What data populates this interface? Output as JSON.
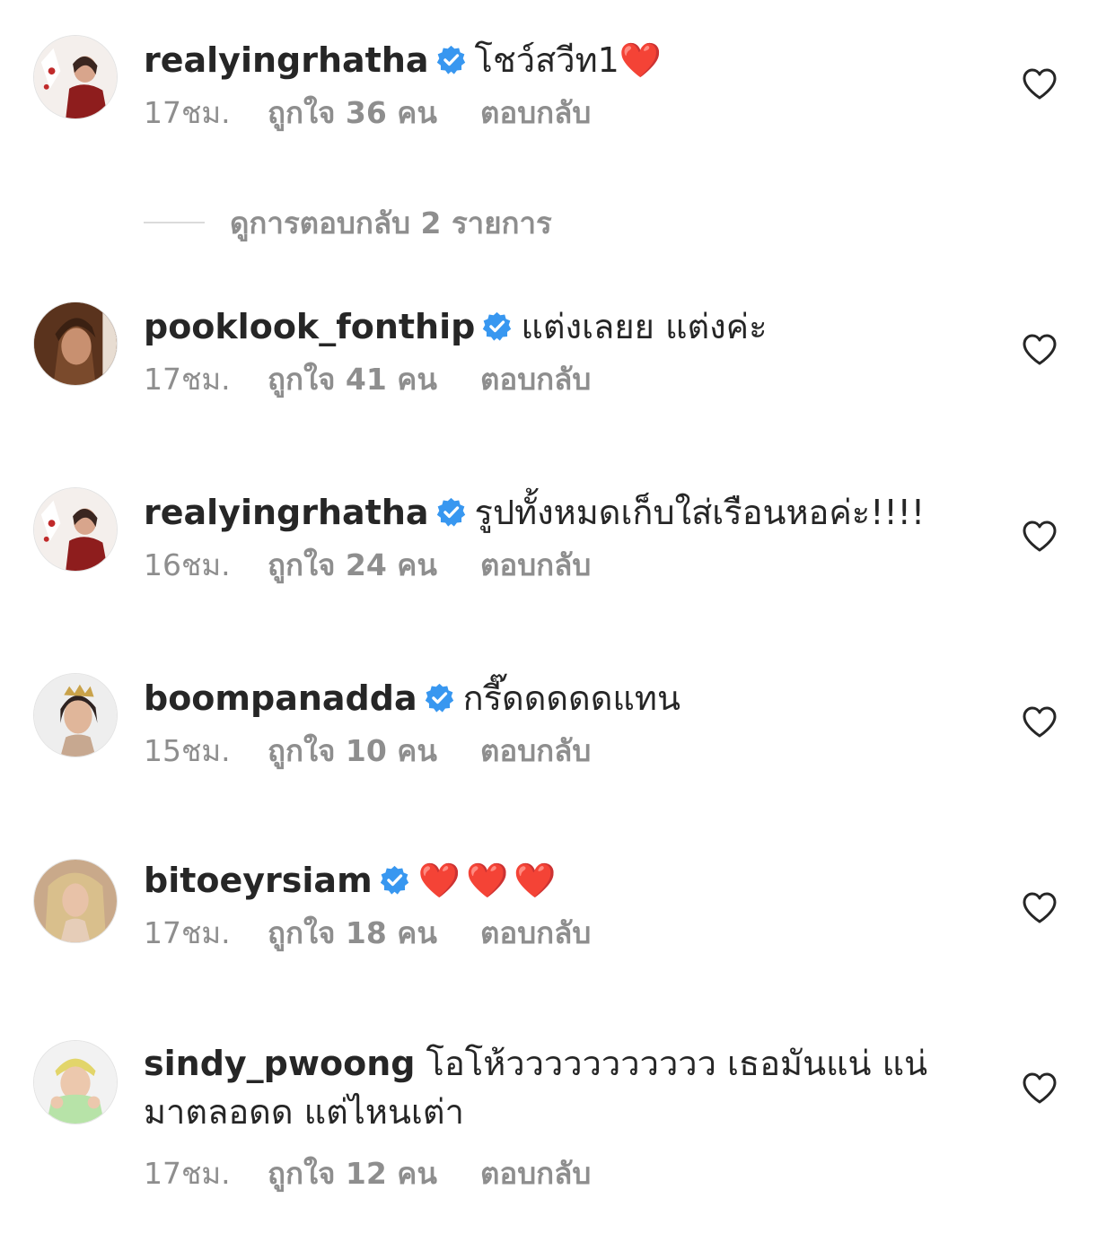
{
  "colors": {
    "text": "#262626",
    "secondary": "#8e8e8e",
    "verified": "#3897f0",
    "heart_emoji": "#e0121f"
  },
  "comments": [
    {
      "username": "realyingrhatha",
      "verified": true,
      "text": "โชว์สวีท1❤️",
      "time": "17ชม.",
      "likes": "ถูกใจ 36 คน",
      "reply": "ตอบกลับ"
    },
    {
      "username": "pooklook_fonthip",
      "verified": true,
      "text": "แต่งเลยย แต่งค่ะ",
      "time": "17ชม.",
      "likes": "ถูกใจ 41 คน",
      "reply": "ตอบกลับ"
    },
    {
      "username": "realyingrhatha",
      "verified": true,
      "text": "รูปทั้งหมดเก็บใส่เรือนหอค่ะ!!!!",
      "time": "16ชม.",
      "likes": "ถูกใจ 24 คน",
      "reply": "ตอบกลับ"
    },
    {
      "username": "boompanadda",
      "verified": true,
      "text": "กรี๊ดดดดดแทน",
      "time": "15ชม.",
      "likes": "ถูกใจ 10 คน",
      "reply": "ตอบกลับ"
    },
    {
      "username": "bitoeyrsiam",
      "verified": true,
      "text": "❤️❤️❤️",
      "time": "17ชม.",
      "likes": "ถูกใจ 18 คน",
      "reply": "ตอบกลับ"
    },
    {
      "username": "sindy_pwoong",
      "verified": false,
      "text": "โอโห้ววววววววววว เธอมันแน่ แน่",
      "text_line2": "มาตลอดด แต่ไหนเต่า",
      "time": "17ชม.",
      "likes": "ถูกใจ 12 คน",
      "reply": "ตอบกลับ"
    }
  ],
  "view_replies": {
    "label": "ดูการตอบกลับ 2 รายการ"
  }
}
